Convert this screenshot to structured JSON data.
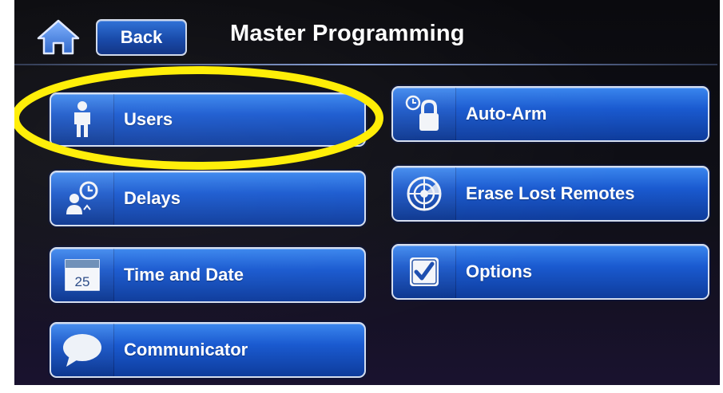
{
  "header": {
    "back_label": "Back",
    "title": "Master Programming",
    "home_icon": "home-icon"
  },
  "menu": {
    "left": [
      {
        "label": "Users",
        "icon": "person-icon"
      },
      {
        "label": "Delays",
        "icon": "person-clock-icon"
      },
      {
        "label": "Time and Date",
        "icon": "calendar-icon",
        "icon_text": "25"
      },
      {
        "label": "Communicator",
        "icon": "speech-bubble-icon"
      }
    ],
    "right": [
      {
        "label": "Auto-Arm",
        "icon": "clock-lock-icon"
      },
      {
        "label": "Erase Lost Remotes",
        "icon": "radar-icon"
      },
      {
        "label": "Options",
        "icon": "checkbox-icon"
      }
    ]
  },
  "annotation": {
    "highlighted_item": "Users",
    "highlight_color": "#ffee00"
  },
  "colors": {
    "button_blue": "#1a5ad0",
    "background": "#0d0d14",
    "text": "#ffffff"
  }
}
